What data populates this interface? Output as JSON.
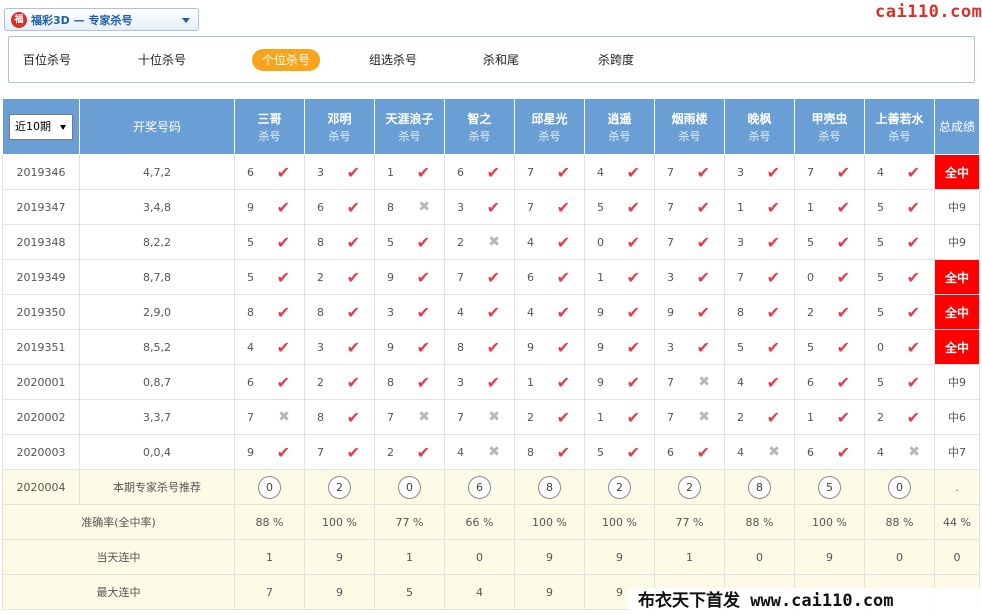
{
  "header": {
    "lottery_icon": "福",
    "lottery_label": "福彩3D — 专家杀号",
    "site": "cai110.com"
  },
  "tabs": [
    {
      "label": "百位杀号",
      "active": false
    },
    {
      "label": "十位杀号",
      "active": false
    },
    {
      "label": "个位杀号",
      "active": true
    },
    {
      "label": "组选杀号",
      "active": false
    },
    {
      "label": "杀和尾",
      "active": false
    },
    {
      "label": "杀跨度",
      "active": false
    }
  ],
  "table": {
    "period_select": "近10期",
    "draw_header": "开奖号码",
    "kill_label": "杀号",
    "total_header": "总成绩",
    "experts": [
      "三哥",
      "邓明",
      "天涯浪子",
      "智之",
      "邱星光",
      "逍遥",
      "烟雨楼",
      "晚枫",
      "甲壳虫",
      "上善若水"
    ],
    "rows": [
      {
        "period": "2019346",
        "draw": "4,7,2",
        "picks": [
          [
            "6",
            1
          ],
          [
            "3",
            1
          ],
          [
            "1",
            1
          ],
          [
            "6",
            1
          ],
          [
            "7",
            1
          ],
          [
            "4",
            1
          ],
          [
            "7",
            1
          ],
          [
            "3",
            1
          ],
          [
            "7",
            1
          ],
          [
            "4",
            1
          ]
        ],
        "total": "全中",
        "full": true
      },
      {
        "period": "2019347",
        "draw": "3,4,8",
        "picks": [
          [
            "9",
            1
          ],
          [
            "6",
            1
          ],
          [
            "8",
            0
          ],
          [
            "3",
            1
          ],
          [
            "7",
            1
          ],
          [
            "5",
            1
          ],
          [
            "7",
            1
          ],
          [
            "1",
            1
          ],
          [
            "1",
            1
          ],
          [
            "5",
            1
          ]
        ],
        "total": "中9",
        "full": false
      },
      {
        "period": "2019348",
        "draw": "8,2,2",
        "picks": [
          [
            "5",
            1
          ],
          [
            "8",
            1
          ],
          [
            "5",
            1
          ],
          [
            "2",
            0
          ],
          [
            "4",
            1
          ],
          [
            "0",
            1
          ],
          [
            "7",
            1
          ],
          [
            "3",
            1
          ],
          [
            "5",
            1
          ],
          [
            "5",
            1
          ]
        ],
        "total": "中9",
        "full": false
      },
      {
        "period": "2019349",
        "draw": "8,7,8",
        "picks": [
          [
            "5",
            1
          ],
          [
            "2",
            1
          ],
          [
            "9",
            1
          ],
          [
            "7",
            1
          ],
          [
            "6",
            1
          ],
          [
            "1",
            1
          ],
          [
            "3",
            1
          ],
          [
            "7",
            1
          ],
          [
            "0",
            1
          ],
          [
            "5",
            1
          ]
        ],
        "total": "全中",
        "full": true
      },
      {
        "period": "2019350",
        "draw": "2,9,0",
        "picks": [
          [
            "8",
            1
          ],
          [
            "8",
            1
          ],
          [
            "3",
            1
          ],
          [
            "4",
            1
          ],
          [
            "4",
            1
          ],
          [
            "9",
            1
          ],
          [
            "9",
            1
          ],
          [
            "8",
            1
          ],
          [
            "2",
            1
          ],
          [
            "5",
            1
          ]
        ],
        "total": "全中",
        "full": true
      },
      {
        "period": "2019351",
        "draw": "8,5,2",
        "picks": [
          [
            "4",
            1
          ],
          [
            "3",
            1
          ],
          [
            "9",
            1
          ],
          [
            "8",
            1
          ],
          [
            "9",
            1
          ],
          [
            "9",
            1
          ],
          [
            "3",
            1
          ],
          [
            "5",
            1
          ],
          [
            "5",
            1
          ],
          [
            "0",
            1
          ]
        ],
        "total": "全中",
        "full": true
      },
      {
        "period": "2020001",
        "draw": "0,8,7",
        "picks": [
          [
            "6",
            1
          ],
          [
            "2",
            1
          ],
          [
            "8",
            1
          ],
          [
            "3",
            1
          ],
          [
            "1",
            1
          ],
          [
            "9",
            1
          ],
          [
            "7",
            0
          ],
          [
            "4",
            1
          ],
          [
            "6",
            1
          ],
          [
            "5",
            1
          ]
        ],
        "total": "中9",
        "full": false
      },
      {
        "period": "2020002",
        "draw": "3,3,7",
        "picks": [
          [
            "7",
            0
          ],
          [
            "8",
            1
          ],
          [
            "7",
            0
          ],
          [
            "7",
            0
          ],
          [
            "2",
            1
          ],
          [
            "1",
            1
          ],
          [
            "7",
            0
          ],
          [
            "2",
            1
          ],
          [
            "1",
            1
          ],
          [
            "2",
            1
          ]
        ],
        "total": "中6",
        "full": false
      },
      {
        "period": "2020003",
        "draw": "0,0,4",
        "picks": [
          [
            "9",
            1
          ],
          [
            "7",
            1
          ],
          [
            "2",
            1
          ],
          [
            "4",
            0
          ],
          [
            "8",
            1
          ],
          [
            "5",
            1
          ],
          [
            "6",
            1
          ],
          [
            "4",
            0
          ],
          [
            "6",
            1
          ],
          [
            "4",
            0
          ]
        ],
        "total": "中7",
        "full": false
      }
    ],
    "recommend": {
      "period": "2020004",
      "label": "本期专家杀号推荐",
      "balls": [
        "0",
        "2",
        "0",
        "6",
        "8",
        "2",
        "2",
        "8",
        "5",
        "0"
      ],
      "total": "."
    },
    "accuracy": {
      "label": "准确率(全中率)",
      "values": [
        "88 %",
        "100 %",
        "77 %",
        "66 %",
        "100 %",
        "100 %",
        "77 %",
        "88 %",
        "100 %",
        "88 %"
      ],
      "total": "44 %"
    },
    "today_streak": {
      "label": "当天连中",
      "values": [
        "1",
        "9",
        "1",
        "0",
        "9",
        "9",
        "1",
        "0",
        "9",
        "0"
      ],
      "total": "0"
    },
    "max_streak": {
      "label": "最大连中",
      "values": [
        "7",
        "9",
        "5",
        "4",
        "9",
        "9",
        "",
        "",
        "",
        ""
      ],
      "total": ""
    }
  },
  "watermark": "布衣天下首发 www.cai110.com",
  "colors": {
    "header_blue": "#6a9fd6",
    "hit_red": "#e53c4b",
    "full_hit_bg": "#ff0000",
    "active_tab": "#f7a51c",
    "yellow_row": "#fdfbe6"
  }
}
